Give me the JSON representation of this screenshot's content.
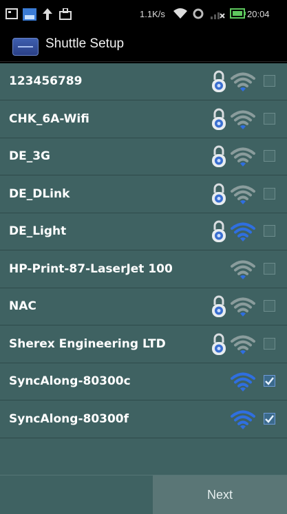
{
  "status_bar": {
    "speed": "1.1K/s",
    "time": "20:04"
  },
  "app": {
    "title": "Shuttle Setup"
  },
  "networks": [
    {
      "ssid": "123456789",
      "locked": true,
      "signal": "weak",
      "checked": false
    },
    {
      "ssid": "CHK_6A-Wifi",
      "locked": true,
      "signal": "weak",
      "checked": false
    },
    {
      "ssid": "DE_3G",
      "locked": true,
      "signal": "weak",
      "checked": false
    },
    {
      "ssid": "DE_DLink",
      "locked": true,
      "signal": "weak",
      "checked": false
    },
    {
      "ssid": "DE_Light",
      "locked": true,
      "signal": "strong",
      "checked": false
    },
    {
      "ssid": "HP-Print-87-LaserJet 100",
      "locked": false,
      "signal": "weak",
      "checked": false
    },
    {
      "ssid": "NAC",
      "locked": true,
      "signal": "weak",
      "checked": false
    },
    {
      "ssid": "Sherex Engineering LTD",
      "locked": true,
      "signal": "weak",
      "checked": false
    },
    {
      "ssid": "SyncAlong-80300c",
      "locked": false,
      "signal": "strong",
      "checked": true
    },
    {
      "ssid": "SyncAlong-80300f",
      "locked": false,
      "signal": "strong",
      "checked": true
    }
  ],
  "footer": {
    "next_label": "Next"
  },
  "colors": {
    "list_background": "#3f6262",
    "signal_strong": "#2f6fe0",
    "signal_weak": "#8a9c9c",
    "text": "#ffffff"
  },
  "icons": {
    "lock": "lock-icon",
    "wifi": "wifi-signal-icon",
    "checkbox": "checkbox-icon"
  }
}
